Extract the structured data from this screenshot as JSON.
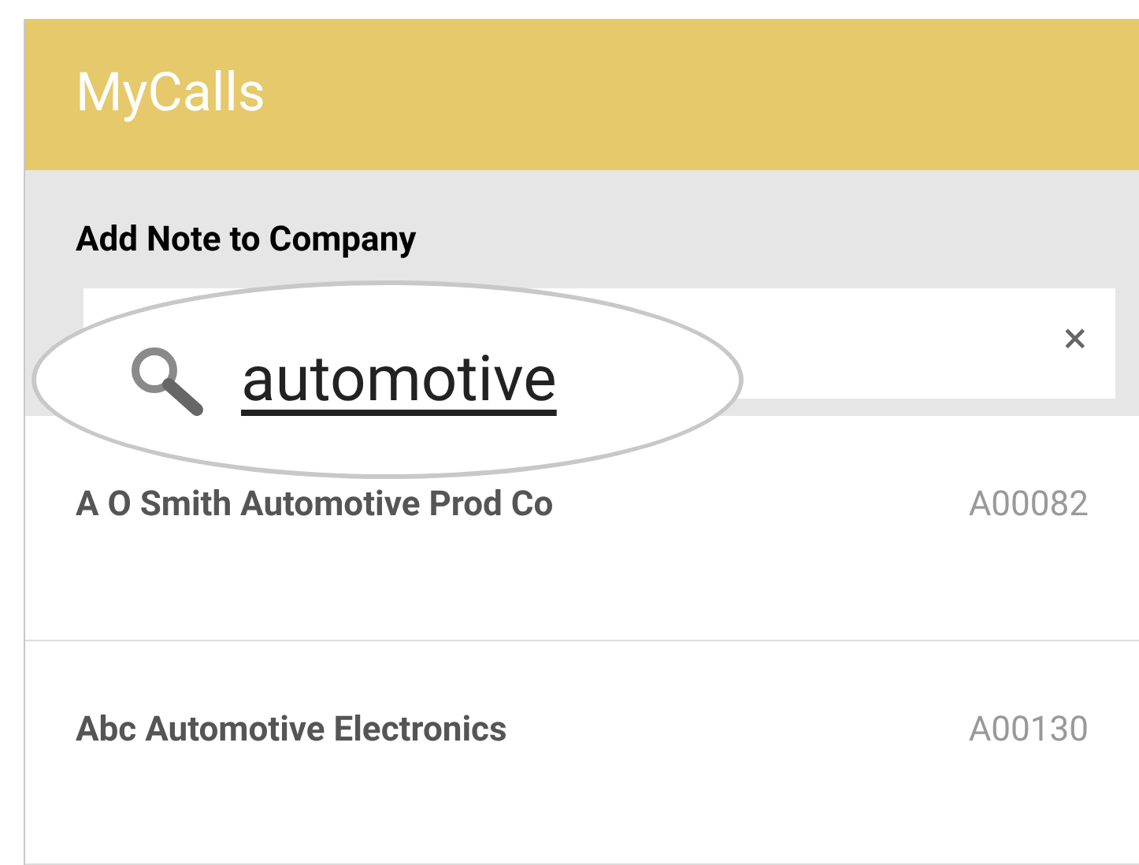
{
  "header": {
    "title": "MyCalls"
  },
  "section": {
    "title": "Add Note to Company"
  },
  "search": {
    "value": "automotive",
    "clear": "×"
  },
  "results": [
    {
      "name": "A O Smith Automotive Prod Co",
      "code": "A00082"
    },
    {
      "name": "Abc Automotive Electronics",
      "code": "A00130"
    }
  ]
}
